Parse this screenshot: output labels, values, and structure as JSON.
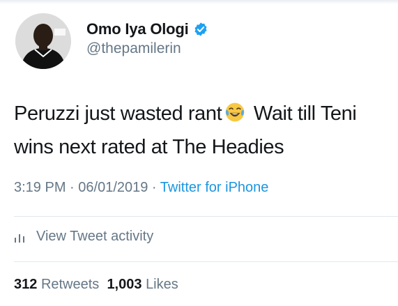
{
  "tweet": {
    "author": {
      "display_name": "Omo Iya Ologi",
      "handle": "@thepamilerin",
      "verified": true
    },
    "text_part1": "Peruzzi just wasted rant",
    "emoji": "face-with-tears-of-joy",
    "text_part2": " Wait till Teni",
    "text_part3": "wins next rated at The Headies",
    "time": "3:19 PM",
    "separator1": " · ",
    "date": "06/01/2019",
    "separator2": " · ",
    "source": "Twitter for iPhone",
    "activity_label": "View Tweet activity",
    "retweets_count": "312",
    "retweets_label": "Retweets",
    "likes_count": "1,003",
    "likes_label": "Likes"
  },
  "colors": {
    "text": "#14171a",
    "secondary": "#657786",
    "link": "#1b95e0",
    "verified": "#1da1f2",
    "divider": "#e1e8ed"
  }
}
